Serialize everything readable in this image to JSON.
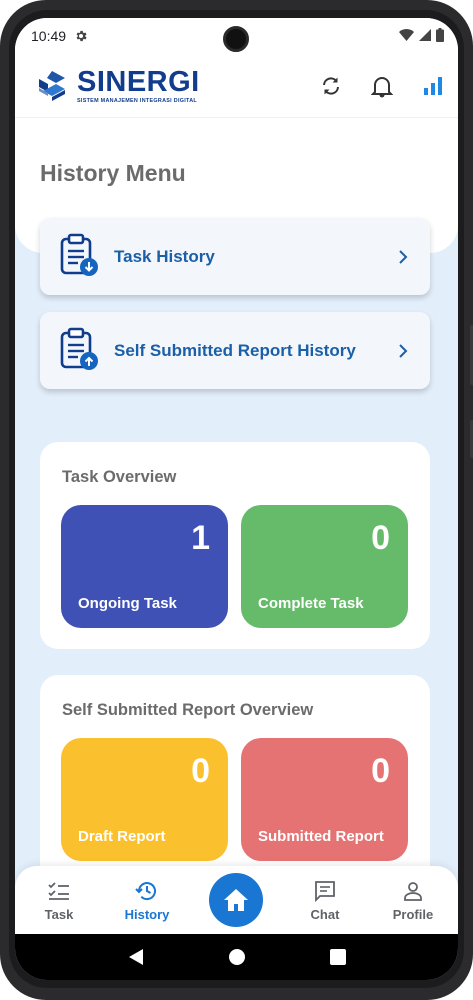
{
  "status_bar": {
    "time": "10:49",
    "icons": [
      "gear-icon",
      "wifi-icon",
      "cellular-icon",
      "battery-icon"
    ]
  },
  "header": {
    "logo_title": "SINERGI",
    "logo_subtitle": "SISTEM MANAJEMEN INTEGRASI DIGITAL",
    "icons": [
      "sync-icon",
      "bell-icon",
      "signal-bars-icon"
    ],
    "brand_color": "#123c8c"
  },
  "page": {
    "title": "History Menu"
  },
  "menu": {
    "items": [
      {
        "label": "Task History",
        "icon": "clipboard-download-icon"
      },
      {
        "label": "Self Submitted Report History",
        "icon": "clipboard-upload-icon"
      }
    ]
  },
  "task_overview": {
    "title": "Task Overview",
    "stats": [
      {
        "value": "1",
        "label": "Ongoing Task",
        "color": "#3f51b5"
      },
      {
        "value": "0",
        "label": "Complete Task",
        "color": "#66bb6a"
      }
    ]
  },
  "report_overview": {
    "title": "Self Submitted Report Overview",
    "stats": [
      {
        "value": "0",
        "label": "Draft Report",
        "color": "#fbc02d"
      },
      {
        "value": "0",
        "label": "Submitted Report",
        "color": "#e57373"
      }
    ]
  },
  "bottom_nav": {
    "items": [
      {
        "label": "Task",
        "icon": "checklist-icon"
      },
      {
        "label": "History",
        "icon": "history-icon",
        "active": true
      },
      {
        "label": "Chat",
        "icon": "chat-icon"
      },
      {
        "label": "Profile",
        "icon": "person-icon"
      }
    ],
    "home_icon": "home-icon",
    "accent": "#1976d2"
  },
  "system_nav": {
    "icons": [
      "back-icon",
      "home-circle-icon",
      "recents-icon"
    ]
  }
}
